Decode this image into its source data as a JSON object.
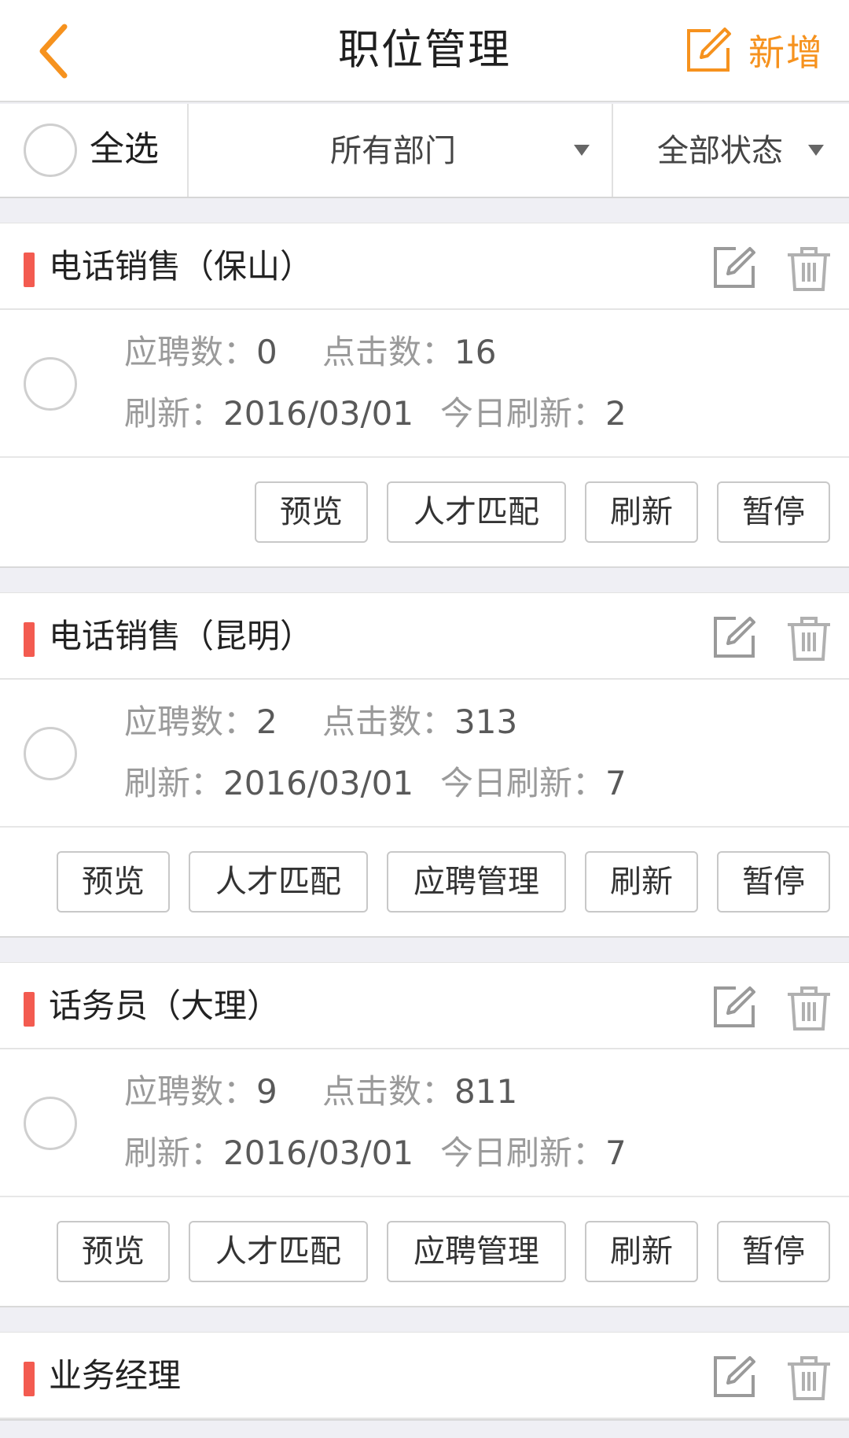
{
  "header": {
    "title": "职位管理",
    "add_label": "新增",
    "accent_color": "#f6921e"
  },
  "filter": {
    "select_all": "全选",
    "department": "所有部门",
    "status": "全部状态"
  },
  "labels": {
    "applies": "应聘数：",
    "clicks": "点击数：",
    "refresh": "刷新：",
    "today_refresh": "今日刷新："
  },
  "jobs": [
    {
      "name": "电话销售（保山）",
      "applies": "0",
      "clicks": "16",
      "refresh_date": "2016/03/01",
      "today_refresh": "2",
      "actions": [
        "预览",
        "人才匹配",
        "刷新",
        "暂停"
      ]
    },
    {
      "name": "电话销售（昆明）",
      "applies": "2",
      "clicks": "313",
      "refresh_date": "2016/03/01",
      "today_refresh": "7",
      "actions": [
        "预览",
        "人才匹配",
        "应聘管理",
        "刷新",
        "暂停"
      ]
    },
    {
      "name": "话务员（大理）",
      "applies": "9",
      "clicks": "811",
      "refresh_date": "2016/03/01",
      "today_refresh": "7",
      "actions": [
        "预览",
        "人才匹配",
        "应聘管理",
        "刷新",
        "暂停"
      ]
    },
    {
      "name": "业务经理"
    }
  ]
}
